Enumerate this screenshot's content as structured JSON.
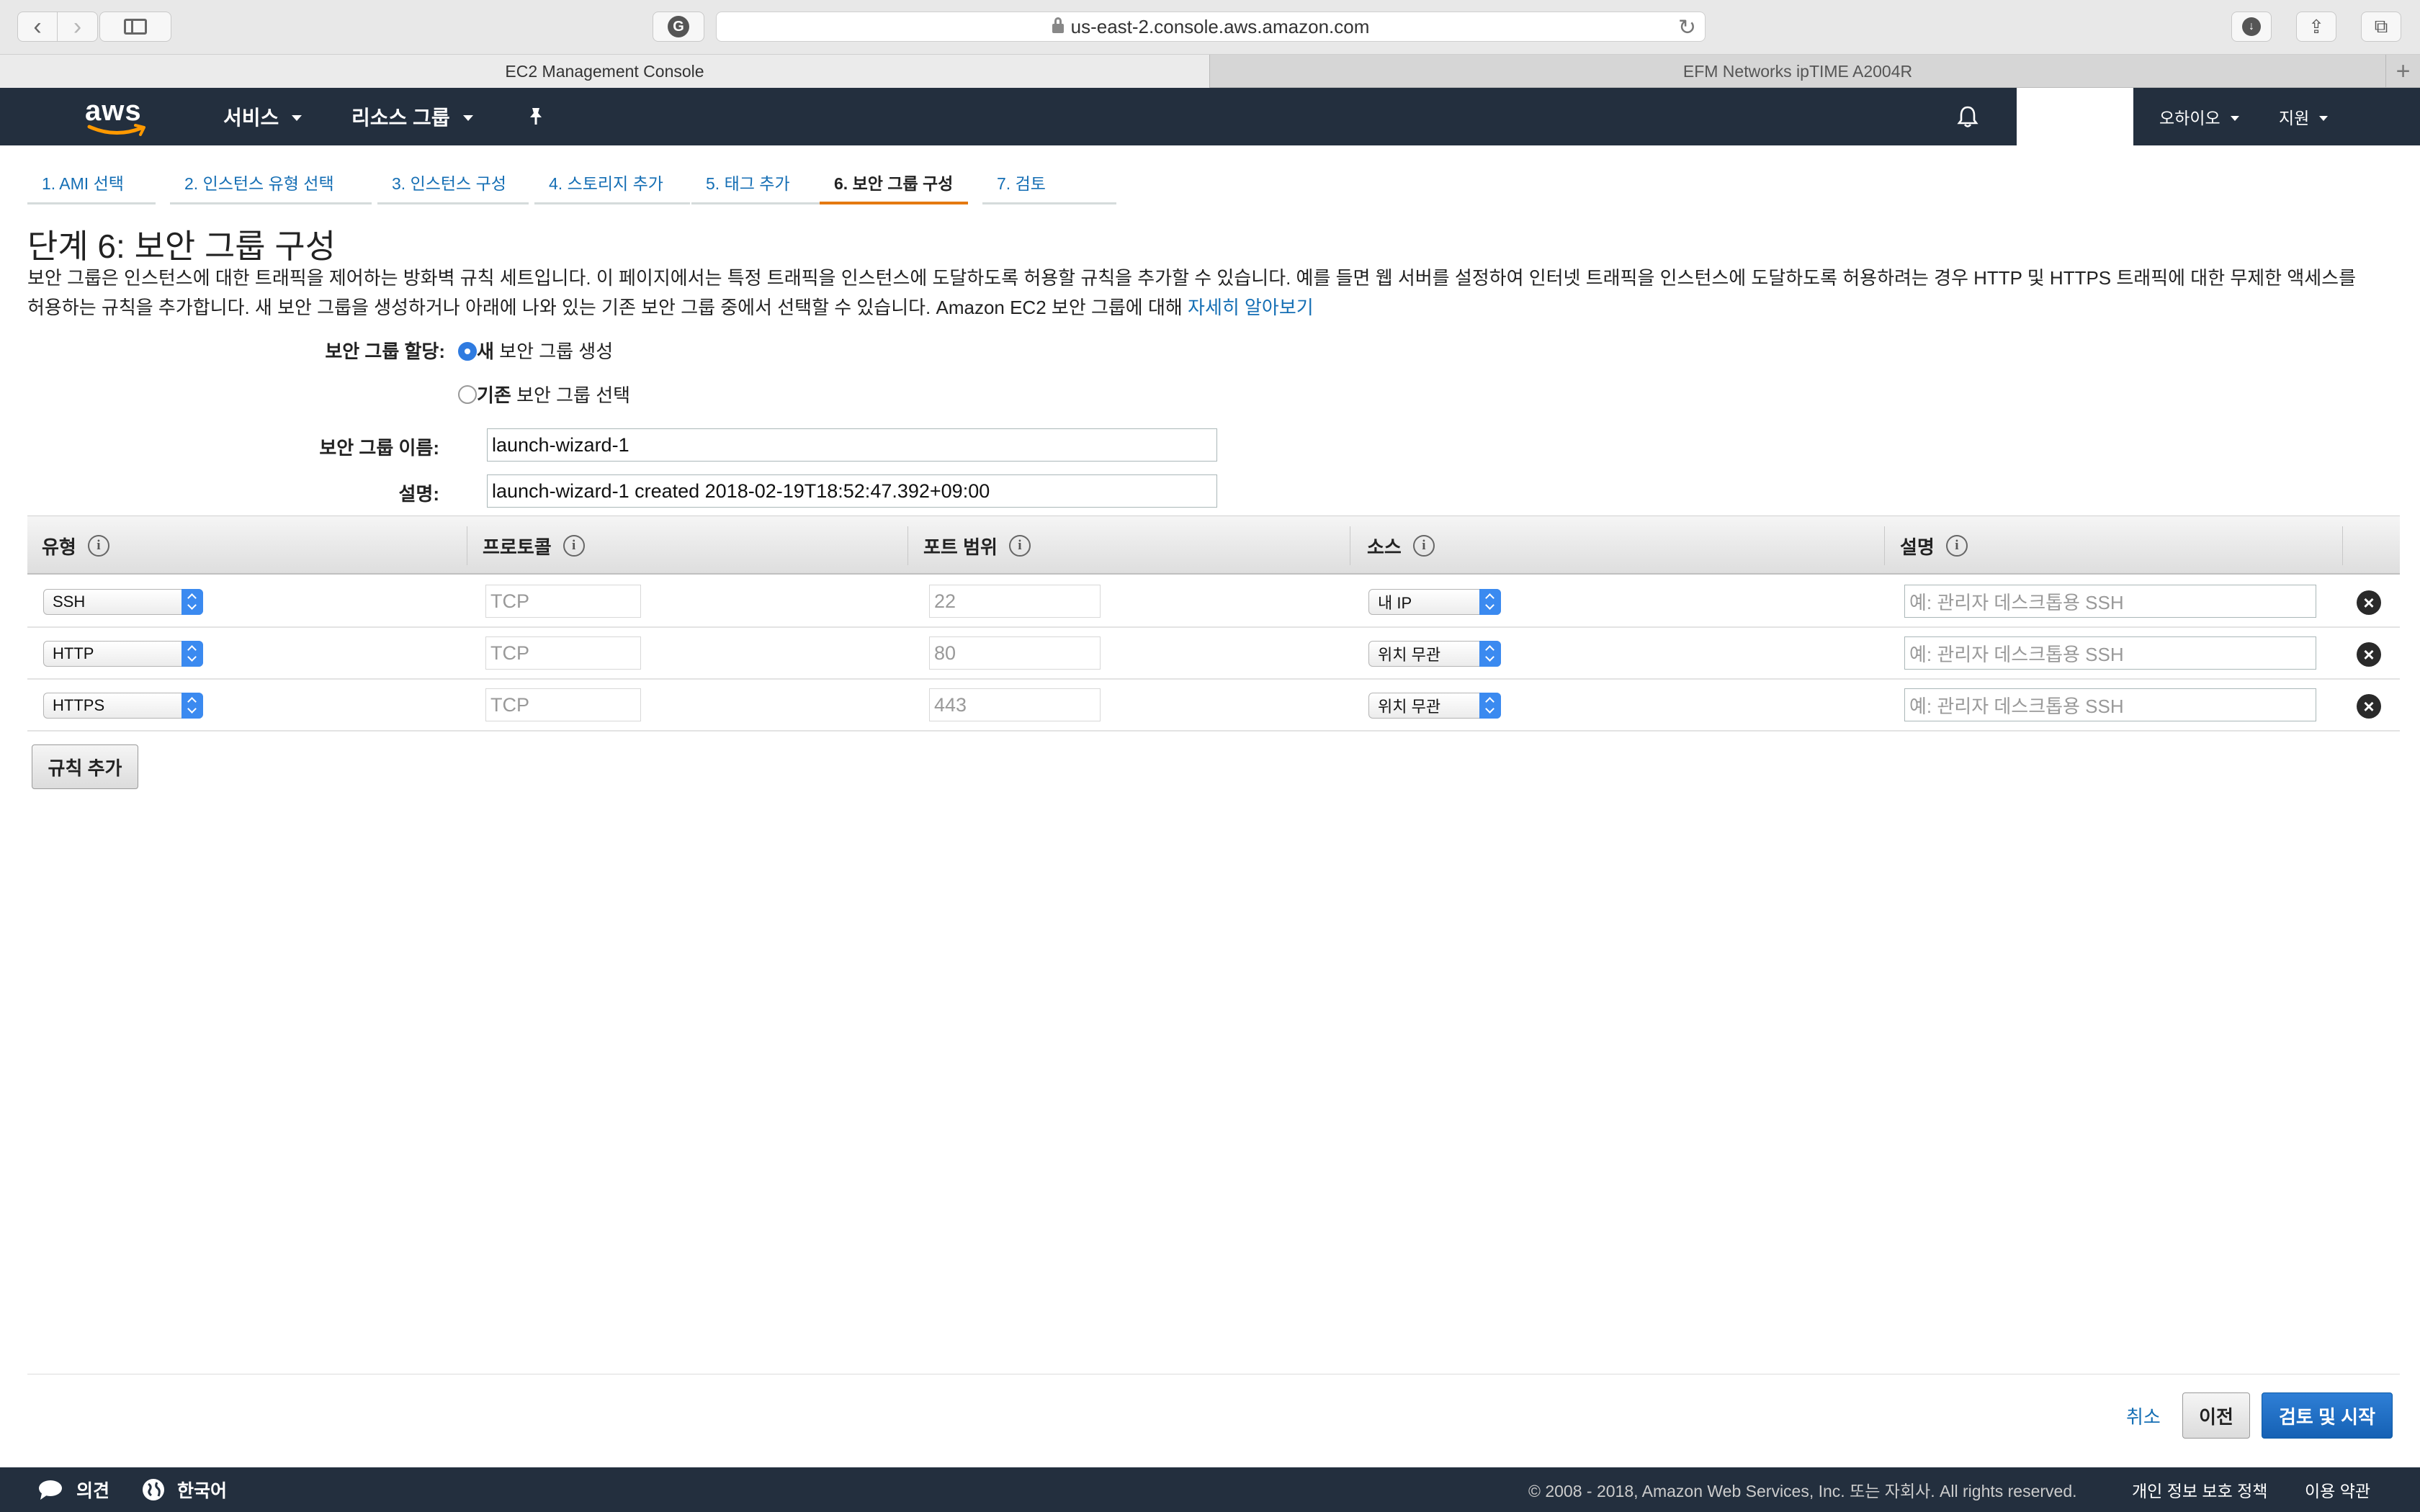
{
  "browser": {
    "url": "us-east-2.console.aws.amazon.com",
    "tabs": [
      {
        "label": "EC2 Management Console"
      },
      {
        "label": "EFM Networks ipTIME A2004R"
      }
    ]
  },
  "nav": {
    "services": "서비스",
    "resource_groups": "리소스 그룹",
    "region": "오하이오",
    "support": "지원"
  },
  "steps": [
    {
      "label": "1. AMI 선택"
    },
    {
      "label": "2. 인스턴스 유형 선택"
    },
    {
      "label": "3. 인스턴스 구성"
    },
    {
      "label": "4. 스토리지 추가"
    },
    {
      "label": "5. 태그 추가"
    },
    {
      "label": "6. 보안 그룹 구성"
    },
    {
      "label": "7. 검토"
    }
  ],
  "page": {
    "title": "단계 6: 보안 그룹 구성",
    "description": "보안 그룹은 인스턴스에 대한 트래픽을 제어하는 방화벽 규칙 세트입니다. 이 페이지에서는 특정 트래픽을 인스턴스에 도달하도록 허용할 규칙을 추가할 수 있습니다. 예를 들면 웹 서버를 설정하여 인터넷 트래픽을 인스턴스에 도달하도록 허용하려는 경우 HTTP 및 HTTPS 트래픽에 대한 무제한 액세스를 허용하는 규칙을 추가합니다. 새 보안 그룹을 생성하거나 아래에 나와 있는 기존 보안 그룹 중에서 선택할 수 있습니다. Amazon EC2 보안 그룹에 대해",
    "learn_more": "자세히 알아보기"
  },
  "form": {
    "assign_label": "보안 그룹 할당:",
    "option_new_bold": "새",
    "option_new_rest": " 보안 그룹 생성",
    "option_existing_bold": "기존",
    "option_existing_rest": " 보안 그룹 선택",
    "name_label": "보안 그룹 이름:",
    "name_value": "launch-wizard-1",
    "desc_label": "설명:",
    "desc_value": "launch-wizard-1 created 2018-02-19T18:52:47.392+09:00"
  },
  "table": {
    "headers": {
      "type": "유형",
      "protocol": "프로토콜",
      "port_range": "포트 범위",
      "source": "소스",
      "description": "설명"
    },
    "rows": [
      {
        "type": "SSH",
        "protocol": "TCP",
        "port": "22",
        "source": "내 IP",
        "desc_placeholder": "예: 관리자 데스크톱용 SSH"
      },
      {
        "type": "HTTP",
        "protocol": "TCP",
        "port": "80",
        "source": "위치 무관",
        "desc_placeholder": "예: 관리자 데스크톱용 SSH"
      },
      {
        "type": "HTTPS",
        "protocol": "TCP",
        "port": "443",
        "source": "위치 무관",
        "desc_placeholder": "예: 관리자 데스크톱용 SSH"
      }
    ],
    "add_rule": "규칙 추가"
  },
  "actions": {
    "cancel": "취소",
    "previous": "이전",
    "review_launch": "검토 및 시작"
  },
  "footer": {
    "feedback": "의견",
    "language": "한국어",
    "copyright": "© 2008 - 2018, Amazon Web Services, Inc. 또는 자회사. All rights reserved.",
    "privacy": "개인 정보 보호 정책",
    "terms": "이용 약관"
  },
  "colors": {
    "aws_nav_bg": "#232f3e",
    "link": "#146eb4",
    "active_step": "#e47911",
    "primary_button": "#1561b4"
  }
}
